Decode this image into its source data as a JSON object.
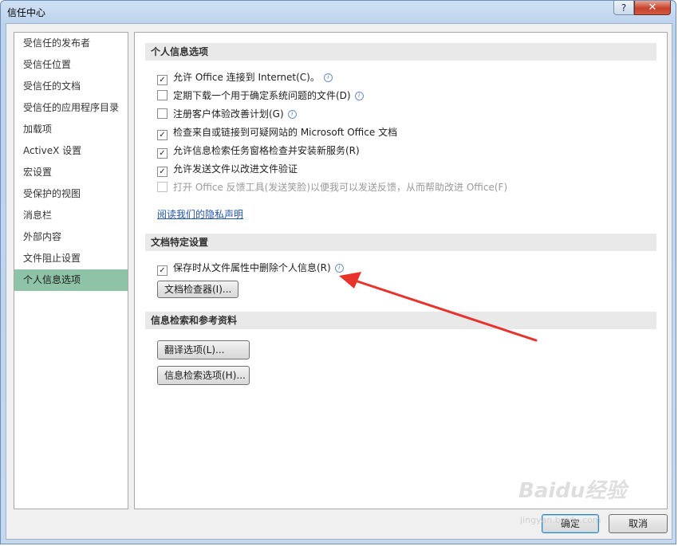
{
  "window": {
    "title": "信任中心",
    "help": "?",
    "close": "✕"
  },
  "nav": {
    "items": [
      "受信任的发布者",
      "受信任位置",
      "受信任的文档",
      "受信任的应用程序目录",
      "加载项",
      "ActiveX 设置",
      "宏设置",
      "受保护的视图",
      "消息栏",
      "外部内容",
      "文件阻止设置",
      "个人信息选项"
    ],
    "selected_index": 11
  },
  "sections": {
    "personal": {
      "title": "个人信息选项",
      "options": [
        {
          "label": "允许 Office 连接到 Internet(C)。",
          "checked": true,
          "info": true
        },
        {
          "label": "定期下载一个用于确定系统问题的文件(D)",
          "checked": false,
          "info": true
        },
        {
          "label": "注册客户体验改善计划(G)",
          "checked": false,
          "info": true
        },
        {
          "label": "检查来自或链接到可疑网站的 Microsoft Office 文档",
          "checked": true,
          "info": false
        },
        {
          "label": "允许信息检索任务窗格检查并安装新服务(R)",
          "checked": true,
          "info": false
        },
        {
          "label": "允许发送文件以改进文件验证",
          "checked": true,
          "info": false
        },
        {
          "label": "打开 Office 反馈工具(发送笑脸)以便我可以发送反馈，从而帮助改进 Office(F)",
          "checked": false,
          "info": false,
          "disabled": true
        }
      ],
      "privacy_link": "阅读我们的隐私声明"
    },
    "doc_specific": {
      "title": "文档特定设置",
      "option": {
        "label": "保存时从文件属性中删除个人信息(R)",
        "checked": true,
        "info": true
      },
      "inspector_button": "文档检查器(I)..."
    },
    "research": {
      "title": "信息检索和参考资料",
      "translate_button": "翻译选项(L)...",
      "research_button": "信息检索选项(H)..."
    }
  },
  "footer": {
    "ok": "确定",
    "cancel": "取消"
  },
  "watermark": {
    "text": "Baidu经验",
    "sub": "jingyan.baidu.com"
  },
  "colors": {
    "selected_nav": "#8fc3a8",
    "arrow": "#e8322c",
    "link": "#2255aa"
  }
}
